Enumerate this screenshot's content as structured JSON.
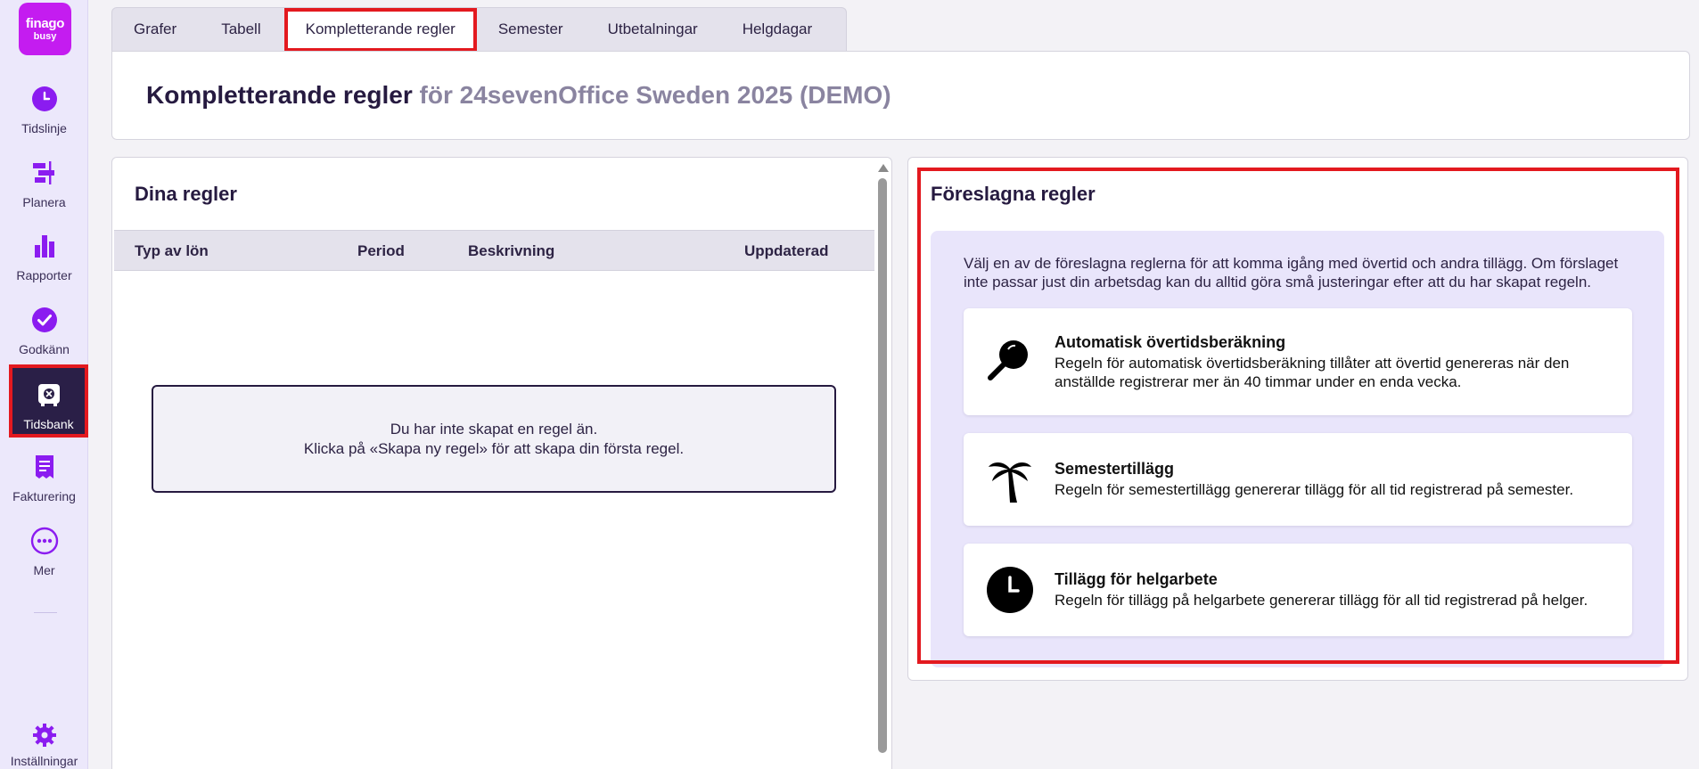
{
  "sidebar": {
    "logo": {
      "line1": "finago",
      "line2": "busy"
    },
    "items": [
      {
        "label": "Tidslinje",
        "icon": "clock-icon"
      },
      {
        "label": "Planera",
        "icon": "gantt-icon"
      },
      {
        "label": "Rapporter",
        "icon": "bar-chart-icon"
      },
      {
        "label": "Godkänn",
        "icon": "check-circle-icon"
      },
      {
        "label": "Tidsbank",
        "icon": "safe-icon",
        "active": true
      },
      {
        "label": "Fakturering",
        "icon": "invoice-icon"
      },
      {
        "label": "Mer",
        "icon": "more-icon"
      }
    ],
    "settings": {
      "label": "Inställningar",
      "icon": "gear-icon"
    }
  },
  "tabs": [
    {
      "label": "Grafer"
    },
    {
      "label": "Tabell"
    },
    {
      "label": "Kompletterande regler",
      "active": true
    },
    {
      "label": "Semester"
    },
    {
      "label": "Utbetalningar"
    },
    {
      "label": "Helgdagar"
    }
  ],
  "header": {
    "title": "Kompletterande regler",
    "subtitle": "för 24sevenOffice Sweden 2025 (DEMO)"
  },
  "my_rules": {
    "title": "Dina regler",
    "columns": [
      "Typ av lön",
      "Period",
      "Beskrivning",
      "Uppdaterad"
    ],
    "empty_line1": "Du har inte skapat en regel än.",
    "empty_line2": "Klicka på «Skapa ny regel» för att skapa din första regel."
  },
  "suggested": {
    "title": "Föreslagna regler",
    "intro": "Välj en av de föreslagna reglerna för att komma igång med övertid och andra tillägg. Om förslaget inte passar just din arbetsdag kan du alltid göra små justeringar efter att du har skapat regeln.",
    "rules": [
      {
        "title": "Automatisk övertidsberäkning",
        "description": "Regeln för automatisk övertidsberäkning tillåter att övertid genereras när den anställde registrerar mer än 40 timmar under en enda vecka.",
        "icon": "magnifier-icon"
      },
      {
        "title": "Semestertillägg",
        "description": "Regeln för semestertillägg genererar tillägg för all tid registrerad på semester.",
        "icon": "palm-tree-icon"
      },
      {
        "title": "Tillägg för helgarbete",
        "description": "Regeln för tillägg på helgarbete genererar tillägg för all tid registrerad på helger.",
        "icon": "clock-icon"
      }
    ]
  },
  "colors": {
    "brand": "#c41cf0",
    "accent": "#8b1cf0",
    "highlight": "#e3191f",
    "sidebar_active": "#2a1f47"
  }
}
